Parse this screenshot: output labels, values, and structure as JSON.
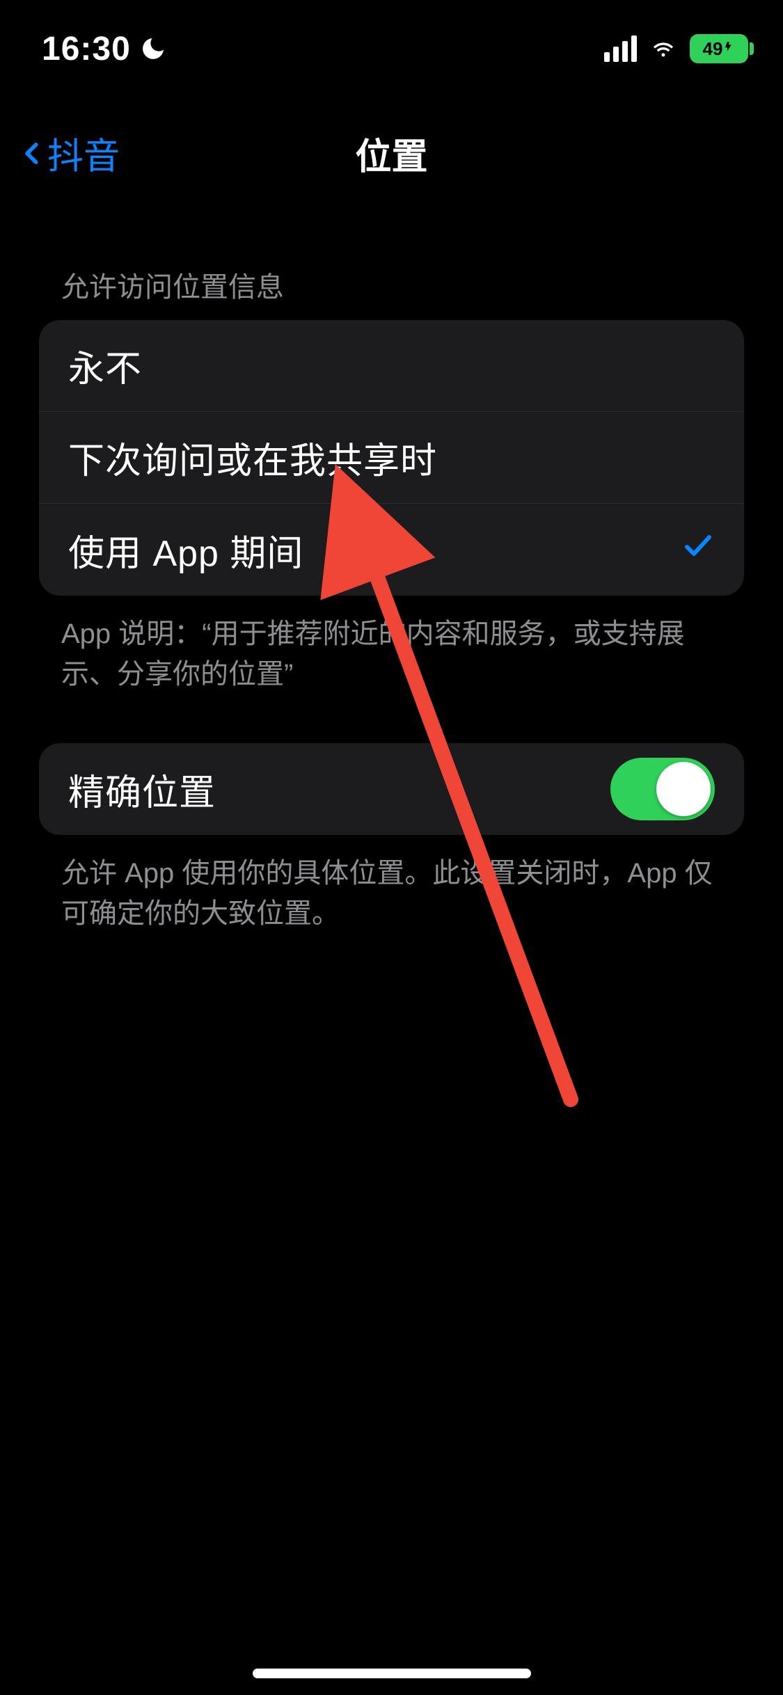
{
  "status": {
    "time": "16:30",
    "battery_text": "49"
  },
  "nav": {
    "back_label": "抖音",
    "title": "位置"
  },
  "sections": {
    "location_access": {
      "header": "允许访问位置信息",
      "options": [
        {
          "label": "永不",
          "selected": false
        },
        {
          "label": "下次询问或在我共享时",
          "selected": false
        },
        {
          "label": "使用 App 期间",
          "selected": true
        }
      ],
      "footer": "App 说明：“用于推荐附近的内容和服务，或支持展示、分享你的位置”"
    },
    "precise": {
      "label": "精确位置",
      "enabled": true,
      "footer": "允许 App 使用你的具体位置。此设置关闭时，App 仅可确定你的大致位置。"
    }
  }
}
